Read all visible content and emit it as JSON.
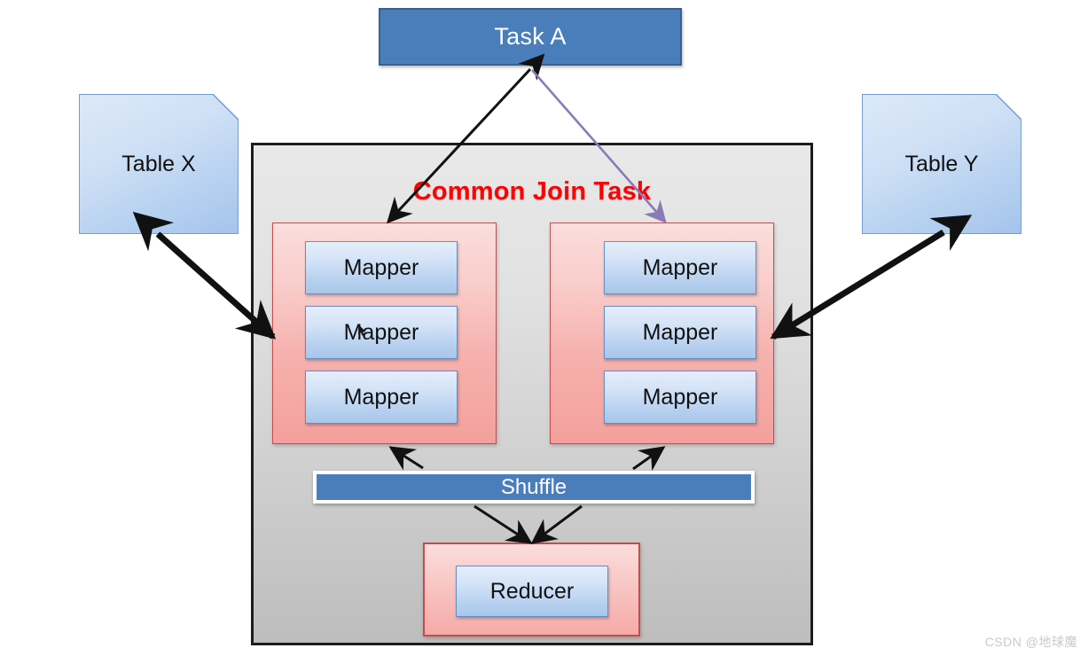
{
  "diagram": {
    "title_text": "Common Join Task",
    "task_a": {
      "label": "Task A"
    },
    "tables": [
      {
        "label": "Table X",
        "name": "table-x"
      },
      {
        "label": "Table Y",
        "name": "table-y"
      }
    ],
    "mapper_groups": [
      {
        "name": "left",
        "mappers": [
          "Mapper",
          "Mapper",
          "Mapper"
        ]
      },
      {
        "name": "right",
        "mappers": [
          "Mapper",
          "Mapper",
          "Mapper"
        ]
      }
    ],
    "shuffle": {
      "label": "Shuffle"
    },
    "reducer": {
      "label": "Reducer"
    },
    "colors": {
      "task_a_fill": "#4a7ebb",
      "task_a_border": "#38618f",
      "title_red": "#fa0000",
      "panel_gray": "#d9d9d9",
      "panel_border": "#1c1c1c",
      "mapper_group_red": "#f6b1ae",
      "mapper_group_border": "#c94a4a",
      "mapper_blue": "#c2d6f0",
      "mapper_border": "#5f8fc6",
      "table_blue": "#b4cff0",
      "table_border": "#6f9ed3",
      "shuffle_fill": "#4a7ebb",
      "arrow_black": "#111111",
      "arrow_purple": "#8b7ab8",
      "watermark_gray": "#c9c9c9"
    }
  },
  "watermark": {
    "text": "CSDN @地球魔"
  }
}
